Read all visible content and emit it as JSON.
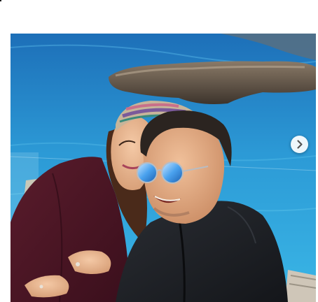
{
  "post": {
    "media_type": "photo",
    "carousel": {
      "next_icon": "chevron-right-icon"
    }
  },
  "colors": {
    "page_background": "#ffffff",
    "button_background": "#ffffff",
    "button_icon": "#555555"
  }
}
